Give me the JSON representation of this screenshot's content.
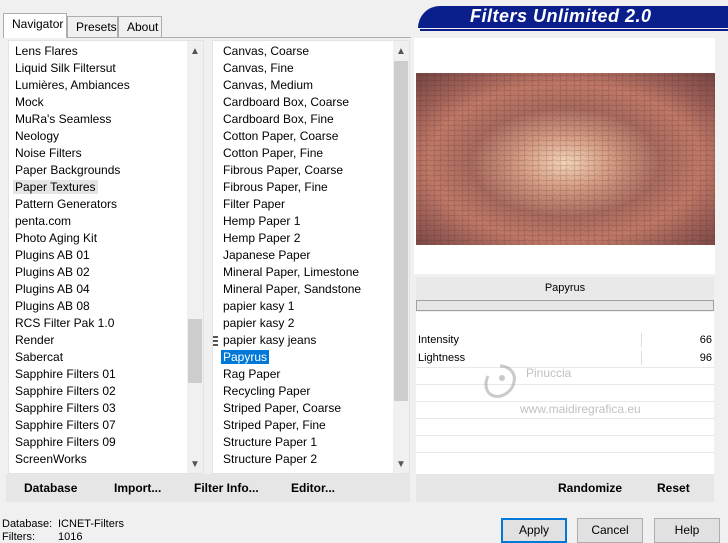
{
  "window": {
    "title": "Filters Unlimited 2.0"
  },
  "tabs": [
    {
      "label": "Navigator"
    },
    {
      "label": "Presets"
    },
    {
      "label": "About"
    }
  ],
  "categories": {
    "items": [
      "Lens Flares",
      "Liquid Silk Filtersut",
      "Lumières, Ambiances",
      "Mock",
      "MuRa's Seamless",
      "Neology",
      "Noise Filters",
      "Paper Backgrounds",
      "Paper Textures",
      "Pattern Generators",
      "penta.com",
      "Photo Aging Kit",
      "Plugins AB 01",
      "Plugins AB 02",
      "Plugins AB 04",
      "Plugins AB 08",
      "RCS Filter Pak 1.0",
      "Render",
      "Sabercat",
      "Sapphire Filters 01",
      "Sapphire Filters 02",
      "Sapphire Filters 03",
      "Sapphire Filters 07",
      "Sapphire Filters 09",
      "ScreenWorks"
    ],
    "selected": "Paper Textures"
  },
  "filters": {
    "items": [
      "Canvas, Coarse",
      "Canvas, Fine",
      "Canvas, Medium",
      "Cardboard Box, Coarse",
      "Cardboard Box, Fine",
      "Cotton Paper, Coarse",
      "Cotton Paper, Fine",
      "Fibrous Paper, Coarse",
      "Fibrous Paper, Fine",
      "Filter Paper",
      "Hemp Paper 1",
      "Hemp Paper 2",
      "Japanese Paper",
      "Mineral Paper, Limestone",
      "Mineral Paper, Sandstone",
      "papier kasy 1",
      "papier kasy 2",
      "papier kasy jeans",
      "Papyrus",
      "Rag Paper",
      "Recycling Paper",
      "Striped Paper, Coarse",
      "Striped Paper, Fine",
      "Structure Paper 1",
      "Structure Paper 2"
    ],
    "selected": "Papyrus"
  },
  "left_toolbar": {
    "database": "Database",
    "import": "Import...",
    "filter_info": "Filter Info...",
    "editor": "Editor..."
  },
  "preview": {
    "filter_name": "Papyrus"
  },
  "parameters": [
    {
      "name": "Intensity",
      "value": "66"
    },
    {
      "name": "Lightness",
      "value": "96"
    }
  ],
  "right_toolbar": {
    "randomize": "Randomize",
    "reset": "Reset"
  },
  "status": {
    "database_label": "Database:",
    "database_value": "ICNET-Filters",
    "filters_label": "Filters:",
    "filters_value": "1016"
  },
  "buttons": {
    "apply": "Apply",
    "cancel": "Cancel",
    "help": "Help"
  },
  "watermark": {
    "line1": "Pinuccia",
    "line2": "www.maidiregrafica.eu"
  },
  "colors": {
    "banner": "#0b1f8c",
    "selection": "#0078d7"
  }
}
